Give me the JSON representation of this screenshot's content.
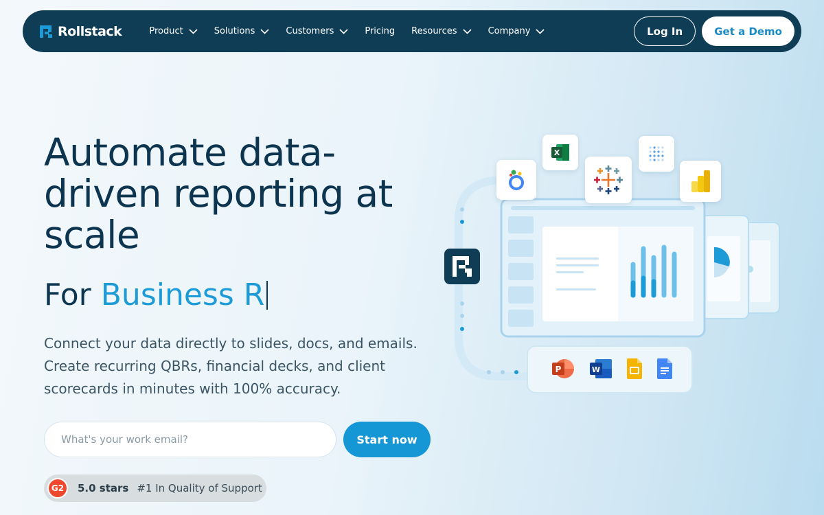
{
  "nav": {
    "logo_text": "Rollstack",
    "items": [
      {
        "label": "Product",
        "dropdown": true
      },
      {
        "label": "Solutions",
        "dropdown": true
      },
      {
        "label": "Customers",
        "dropdown": true
      },
      {
        "label": "Pricing",
        "dropdown": false
      },
      {
        "label": "Resources",
        "dropdown": true
      },
      {
        "label": "Company",
        "dropdown": true
      }
    ],
    "login_label": "Log In",
    "demo_label": "Get a Demo"
  },
  "hero": {
    "headline": "Automate data-driven reporting at scale",
    "for_prefix": "For",
    "for_accent": "Business R",
    "description": "Connect your data directly to slides, docs, and emails. Create recurring QBRs, financial decks, and client scorecards in minutes with 100% accuracy.",
    "email_placeholder": "What's your work email?",
    "start_label": "Start now",
    "g2_label": "G2",
    "stars_label": "5.0 stars",
    "support_label": "#1 In Quality of Support"
  },
  "illustration": {
    "source_icons": [
      "looker-studio-icon",
      "excel-icon",
      "tableau-icon",
      "metabase-icon",
      "power-bi-icon"
    ],
    "destination_icons": [
      "powerpoint-icon",
      "word-icon",
      "google-slides-icon",
      "google-docs-icon"
    ],
    "excel_glyph": "X",
    "powerpoint_glyph": "P",
    "word_glyph": "W"
  },
  "colors": {
    "nav_bg": "#0f3d55",
    "accent": "#1c9bd7",
    "primary_button": "#1597d6",
    "headline": "#0d3550"
  }
}
